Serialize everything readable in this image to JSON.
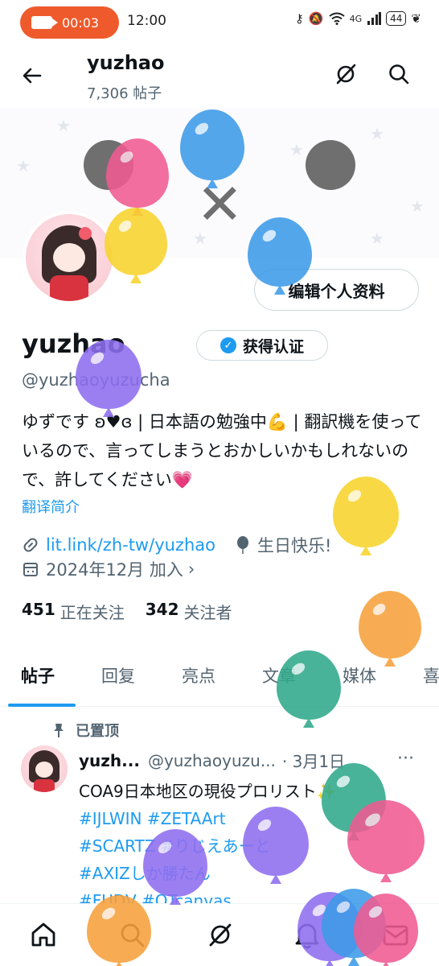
{
  "status_bar": {
    "recording_time": "00:03",
    "clock": "12:00",
    "battery": "44",
    "network": "4G",
    "icons": [
      "key-icon",
      "mute-icon",
      "wifi-icon",
      "signal-icon",
      "battery-icon",
      "leaf-icon"
    ]
  },
  "header": {
    "name": "yuzhao",
    "post_count": "7,306 帖子",
    "icons": [
      "back-arrow-icon",
      "grok-icon",
      "search-icon"
    ]
  },
  "profile": {
    "edit_label": "编辑个人资料",
    "display_name": "yuzhao",
    "verified_label": "获得认证",
    "handle": "@yuzhaoyuzucha",
    "bio": "ゆずです ʚ♥ɞ | 日本語の勉強中💪 | 翻訳機を使っているので、言ってしまうとおかしいかもしれないので、許してください💗",
    "translate_label": "翻译简介",
    "link": "lit.link/zh-tw/yuzhao",
    "birthday": "生日快乐!",
    "joined": "2024年12月 加入",
    "following_count": "451",
    "following_label": "正在关注",
    "followers_count": "342",
    "followers_label": "关注者"
  },
  "tabs": [
    {
      "label": "帖子",
      "active": true
    },
    {
      "label": "回复",
      "active": false
    },
    {
      "label": "亮点",
      "active": false
    },
    {
      "label": "文章",
      "active": false
    },
    {
      "label": "媒体",
      "active": false
    },
    {
      "label": "喜",
      "active": false
    }
  ],
  "post": {
    "pinned_label": "已置顶",
    "name": "yuzh...",
    "handle": "@yuzhaoyuzu...",
    "date": "· 3月1日",
    "more": "···",
    "text_line1": "COA9日本地区の現役プロリスト✨",
    "tags_line2": "#IJLWIN #ZETAArt",
    "tags_line3": "#SCARTZ #りじえあーと",
    "tags_line4": "#AXIZしか勝たん",
    "tags_line5": "#FUDV #OTcanvas"
  },
  "bottom_nav": [
    "home-icon",
    "search-icon",
    "grok-icon",
    "notifications-icon",
    "messages-icon"
  ],
  "colors": {
    "accent": "#1d9bf0",
    "recording": "#ef5a2c",
    "text_primary": "#0f1419",
    "text_secondary": "#536471",
    "balloon_blue": "#3d9be9",
    "balloon_pink": "#f05b92",
    "balloon_yellow": "#f8d42c",
    "balloon_purple": "#8e6ef0",
    "balloon_orange": "#f7a13c",
    "balloon_green": "#2fa98a"
  }
}
